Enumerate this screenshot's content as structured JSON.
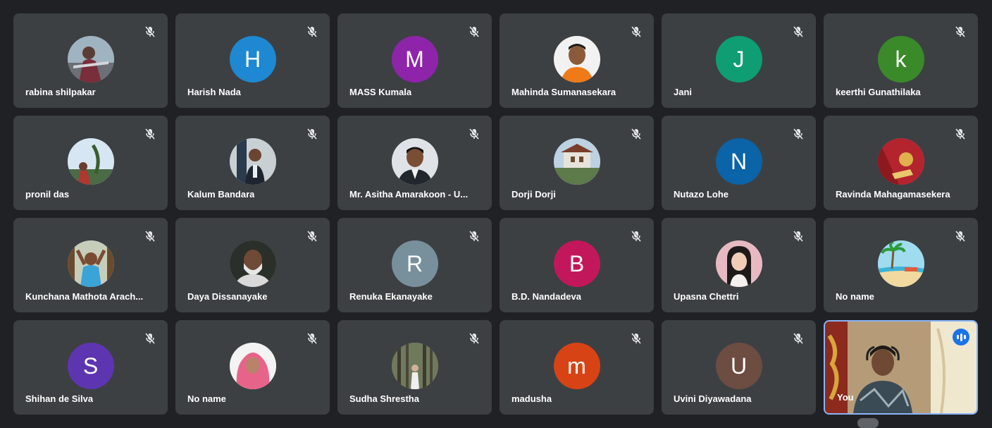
{
  "participants": [
    {
      "name": "rabina shilpakar",
      "avatar_type": "photo",
      "muted": true
    },
    {
      "name": "Harish Nada",
      "avatar_type": "letter",
      "letter": "H",
      "color": "#1e88d2",
      "muted": true
    },
    {
      "name": "MASS Kumala",
      "avatar_type": "letter",
      "letter": "M",
      "color": "#8e24aa",
      "muted": true
    },
    {
      "name": "Mahinda Sumanasekara",
      "avatar_type": "photo",
      "muted": true
    },
    {
      "name": "Jani",
      "avatar_type": "letter",
      "letter": "J",
      "color": "#0f9d74",
      "muted": true
    },
    {
      "name": "keerthi Gunathilaka",
      "avatar_type": "letter",
      "letter": "k",
      "color": "#3a8a2a",
      "muted": true
    },
    {
      "name": "pronil das",
      "avatar_type": "photo",
      "muted": true
    },
    {
      "name": "Kalum Bandara",
      "avatar_type": "photo",
      "muted": true
    },
    {
      "name": "Mr. Asitha Amarakoon - U...",
      "avatar_type": "photo",
      "muted": true
    },
    {
      "name": "Dorji Dorji",
      "avatar_type": "photo",
      "muted": true
    },
    {
      "name": "Nutazo Lohe",
      "avatar_type": "letter",
      "letter": "N",
      "color": "#0b63a8",
      "muted": true
    },
    {
      "name": "Ravinda Mahagamasekera",
      "avatar_type": "photo",
      "muted": true
    },
    {
      "name": "Kunchana Mathota Arach...",
      "avatar_type": "photo",
      "muted": true
    },
    {
      "name": "Daya Dissanayake",
      "avatar_type": "photo",
      "muted": true
    },
    {
      "name": "Renuka Ekanayake",
      "avatar_type": "letter",
      "letter": "R",
      "color": "#78909c",
      "muted": true
    },
    {
      "name": "B.D. Nandadeva",
      "avatar_type": "letter",
      "letter": "B",
      "color": "#c2185b",
      "muted": true
    },
    {
      "name": "Upasna Chettri",
      "avatar_type": "photo",
      "muted": true
    },
    {
      "name": "No name",
      "avatar_type": "photo",
      "muted": true
    },
    {
      "name": "Shihan de Silva",
      "avatar_type": "letter",
      "letter": "S",
      "color": "#5e35b1",
      "muted": true
    },
    {
      "name": "No name",
      "avatar_type": "photo",
      "muted": true
    },
    {
      "name": "Sudha Shrestha",
      "avatar_type": "photo",
      "muted": true
    },
    {
      "name": "madusha",
      "avatar_type": "letter",
      "letter": "m",
      "color": "#d84315",
      "muted": true
    },
    {
      "name": "Uvini Diyawadana",
      "avatar_type": "letter",
      "letter": "U",
      "color": "#6d4c41",
      "muted": true
    },
    {
      "name": "You",
      "avatar_type": "video",
      "muted": false,
      "speaking": true
    }
  ],
  "colors": {
    "background": "#202124",
    "tile": "#3c4043",
    "active_border": "#8ab4f8",
    "speaking_badge": "#1a73e8"
  },
  "icons": {
    "mic": "mic-off-icon",
    "speaking": "audio-level-icon"
  }
}
